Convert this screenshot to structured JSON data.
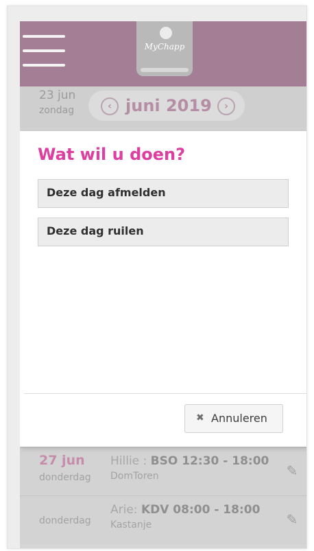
{
  "header": {
    "brand": "MyChapp"
  },
  "calendar": {
    "current_day": "23 jun",
    "current_weekday": "zondag",
    "month_label": "juni 2019",
    "prev_icon": "chevron-left-circle-icon",
    "next_icon": "chevron-right-circle-icon"
  },
  "modal": {
    "title": "Wat wil u doen?",
    "options": [
      {
        "label": "Deze dag afmelden"
      },
      {
        "label": "Deze dag ruilen"
      }
    ],
    "cancel_label": "Annuleren",
    "cancel_icon": "close-icon"
  },
  "list": [
    {
      "date": "27 jun",
      "weekday": "donderdag",
      "name_prefix": "Hillie : ",
      "booking": "BSO 12:30 - 18:00",
      "location": "DomToren"
    },
    {
      "date": "",
      "weekday": "donderdag",
      "name_prefix": "Arie: ",
      "booking": "KDV 08:00 - 18:00",
      "location": "Kastanje"
    }
  ],
  "colors": {
    "header": "#a37e94",
    "accent_pink": "#de3e9f",
    "muted_mauve": "#b58ea6"
  }
}
